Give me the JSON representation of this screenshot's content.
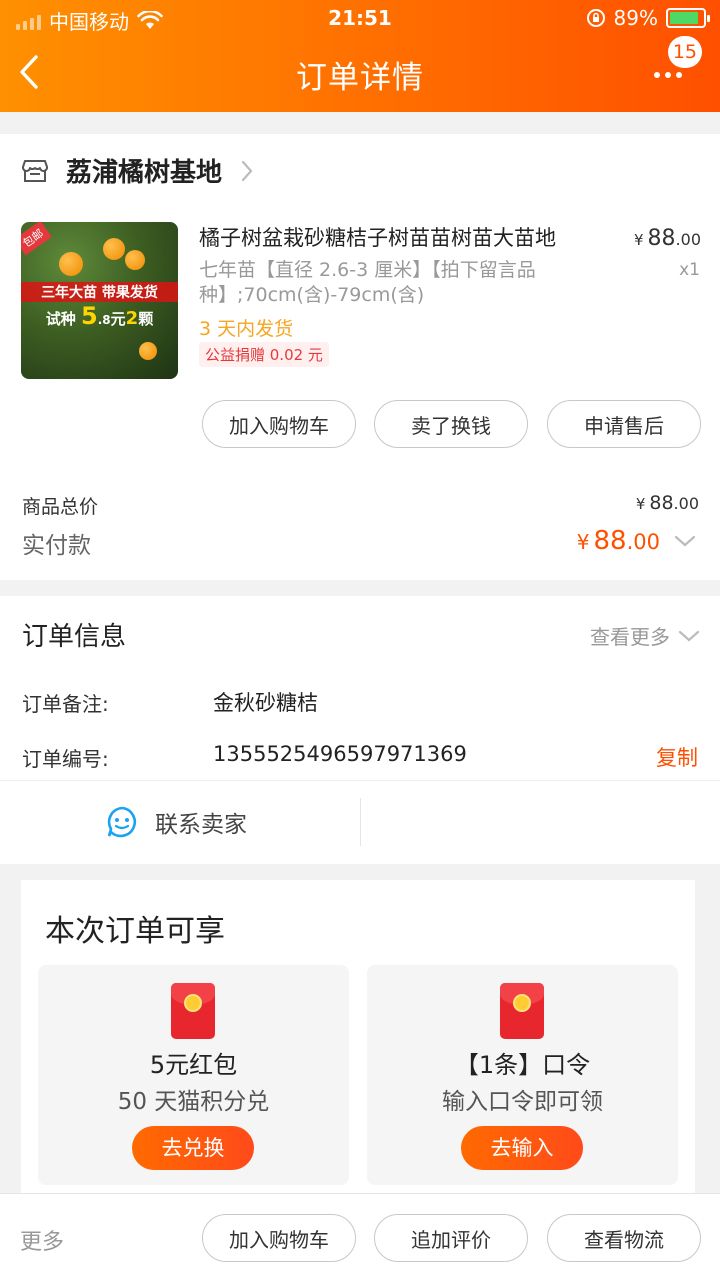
{
  "status": {
    "carrier": "中国移动",
    "time": "21:51",
    "battery": "89%",
    "battery_level": 0.89
  },
  "header": {
    "title": "订单详情",
    "badge": "15"
  },
  "shop": {
    "name": "荔浦橘树基地"
  },
  "product": {
    "title": "橘子树盆栽砂糖桔子树苗苗树苗大苗地",
    "spec": "七年苗【直径 2.6-3 厘米】【拍下留言品种】;70cm(含)-79cm(含)",
    "shipping": "3 天内发货",
    "donation": "公益捐赠 0.02 元",
    "price_yen": "¥",
    "price_int": "88",
    "price_dec": ".00",
    "qty": "x1",
    "image": {
      "tag": "包邮",
      "banner_line1": "三年大苗 带果发货",
      "banner_pre": "试种",
      "banner_num": "5",
      "banner_dec": ".8",
      "banner_mid": "元",
      "banner_cnt": "2",
      "banner_unit": "颗"
    }
  },
  "actions": {
    "add_cart": "加入购物车",
    "sell": "卖了换钱",
    "after_sale": "申请售后"
  },
  "summary": {
    "total_label": "商品总价",
    "total_yen": "¥",
    "total_int": "88",
    "total_dec": ".00",
    "paid_label": "实付款",
    "paid_yen": "¥",
    "paid_int": "88",
    "paid_dec": ".00"
  },
  "order_info": {
    "title": "订单信息",
    "see_more": "查看更多",
    "remark_label": "订单备注:",
    "remark_value": "金秋砂糖桔",
    "number_label": "订单编号:",
    "number_value": "1355525496597971369",
    "copy": "复制"
  },
  "contact": {
    "label": "联系卖家"
  },
  "benefits": {
    "title": "本次订单可享",
    "items": [
      {
        "title": "5元红包",
        "subtitle": "50 天猫积分兑",
        "button": "去兑换"
      },
      {
        "title": "【1条】口令",
        "subtitle": "输入口令即可领",
        "button": "去输入"
      }
    ]
  },
  "bottom": {
    "more": "更多",
    "add_cart": "加入购物车",
    "review": "追加评价",
    "logistics": "查看物流"
  },
  "colors": {
    "accent": "#ff5000",
    "header_start": "#ff9000",
    "ship": "#f6a623"
  }
}
